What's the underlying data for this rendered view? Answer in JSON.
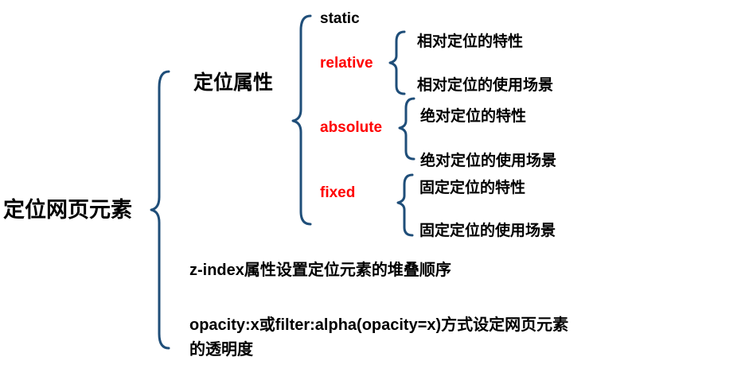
{
  "root": "定位网页元素",
  "branch1": {
    "title": "定位属性",
    "values": [
      {
        "label": "static"
      },
      {
        "label": "relative",
        "children": [
          "相对定位的特性",
          "相对定位的使用场景"
        ]
      },
      {
        "label": "absolute",
        "children": [
          "绝对定位的特性",
          "绝对定位的使用场景"
        ]
      },
      {
        "label": "fixed",
        "children": [
          "固定定位的特性",
          "固定定位的使用场景"
        ]
      }
    ]
  },
  "branch2": "z-index属性设置定位元素的堆叠顺序",
  "branch3": {
    "line1": "opacity:x或filter:alpha(opacity=x)方式设定网页元素",
    "line2": "的透明度"
  },
  "colors": {
    "brace": "#1f4e79",
    "highlight": "#ff0000",
    "text": "#000000"
  }
}
